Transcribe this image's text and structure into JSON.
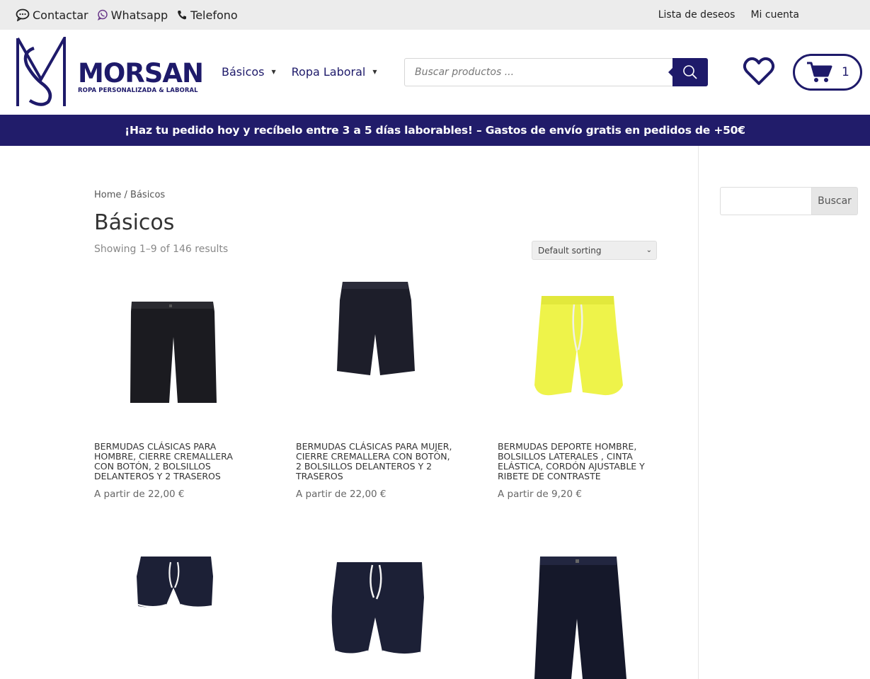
{
  "topbar": {
    "contact": "Contactar",
    "whatsapp": "Whatsapp",
    "phone": "Telefono",
    "wishlist": "Lista de deseos",
    "account": "Mi cuenta"
  },
  "brand": {
    "name": "MORSAN",
    "tagline": "ROPA PERSONALIZADA & LABORAL",
    "color": "#1e1a6a"
  },
  "nav": {
    "items": [
      {
        "label": "Básicos"
      },
      {
        "label": "Ropa Laboral"
      }
    ]
  },
  "search": {
    "placeholder": "Buscar productos ..."
  },
  "cart": {
    "count": "1"
  },
  "banner": {
    "text": "¡Haz tu pedido hoy y recíbelo entre 3 a 5 días laborables! – Gastos de envío gratis en pedidos de +50€"
  },
  "breadcrumb": "Home / Básicos",
  "page_title": "Básicos",
  "results_text": "Showing 1–9 of 146 results",
  "sorting": {
    "selected": "Default sorting"
  },
  "sidebar": {
    "search_button": "Buscar"
  },
  "products": [
    {
      "name": "BERMUDAS CLÁSICAS PARA HOMBRE, CIERRE CREMALLERA CON BOTÓN, 2 BOLSILLOS DELANTEROS Y 2 TRASEROS",
      "price": "A partir de 22,00 €",
      "color": "#1b1b20"
    },
    {
      "name": "BERMUDAS CLÁSICAS PARA MUJER, CIERRE CREMALLERA CON BOTÓN, 2 BOLSILLOS DELANTEROS Y 2 TRASEROS",
      "price": "A partir de 22,00 €",
      "color": "#1d1e2a"
    },
    {
      "name": "BERMUDAS DEPORTE HOMBRE, BOLSILLOS LATERALES , CINTA ELÁSTICA, CORDÓN AJUSTABLE Y RIBETE DE CONTRASTE",
      "price": "A partir de 9,20 €",
      "color": "#eef34a"
    },
    {
      "name": "",
      "price": "",
      "color": "#1c2036"
    },
    {
      "name": "",
      "price": "",
      "color": "#1c2036"
    },
    {
      "name": "",
      "price": "",
      "color": "#15182a"
    }
  ]
}
